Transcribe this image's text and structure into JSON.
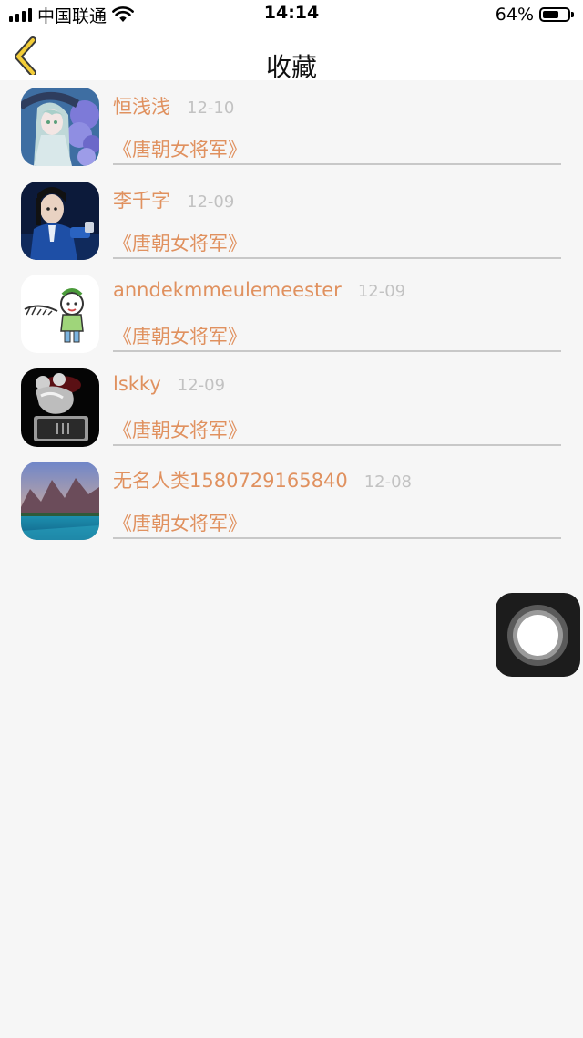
{
  "status_bar": {
    "carrier": "中国联通",
    "time": "14:14",
    "battery_percent": "64%",
    "battery_level": 0.64,
    "signal_icon": "signal-icon",
    "wifi_icon": "wifi-icon"
  },
  "nav": {
    "title": "收藏",
    "back_icon": "chevron-left-icon",
    "accent_color": "#f3cd38"
  },
  "favorites": [
    {
      "name": "恒浅浅",
      "date": "12-10",
      "book": "《唐朝女将军》",
      "avatar": "anime-girl-hydrangea-avatar"
    },
    {
      "name": "李千字",
      "date": "12-09",
      "book": "《唐朝女将军》",
      "avatar": "man-in-blue-robe-avatar"
    },
    {
      "name": "anndekmmeulemeester",
      "date": "12-09",
      "book": "《唐朝女将军》",
      "avatar": "cartoon-child-avatar"
    },
    {
      "name": "lskky",
      "date": "12-09",
      "book": "《唐朝女将军》",
      "avatar": "crystal-mouse-figurine-avatar"
    },
    {
      "name": "无名人类1580729165840",
      "date": "12-08",
      "book": "《唐朝女将军》",
      "avatar": "mountain-lake-avatar"
    }
  ],
  "colors": {
    "name_text": "#e0915f",
    "date_text": "#c2c2c2",
    "background": "#f6f6f6"
  }
}
